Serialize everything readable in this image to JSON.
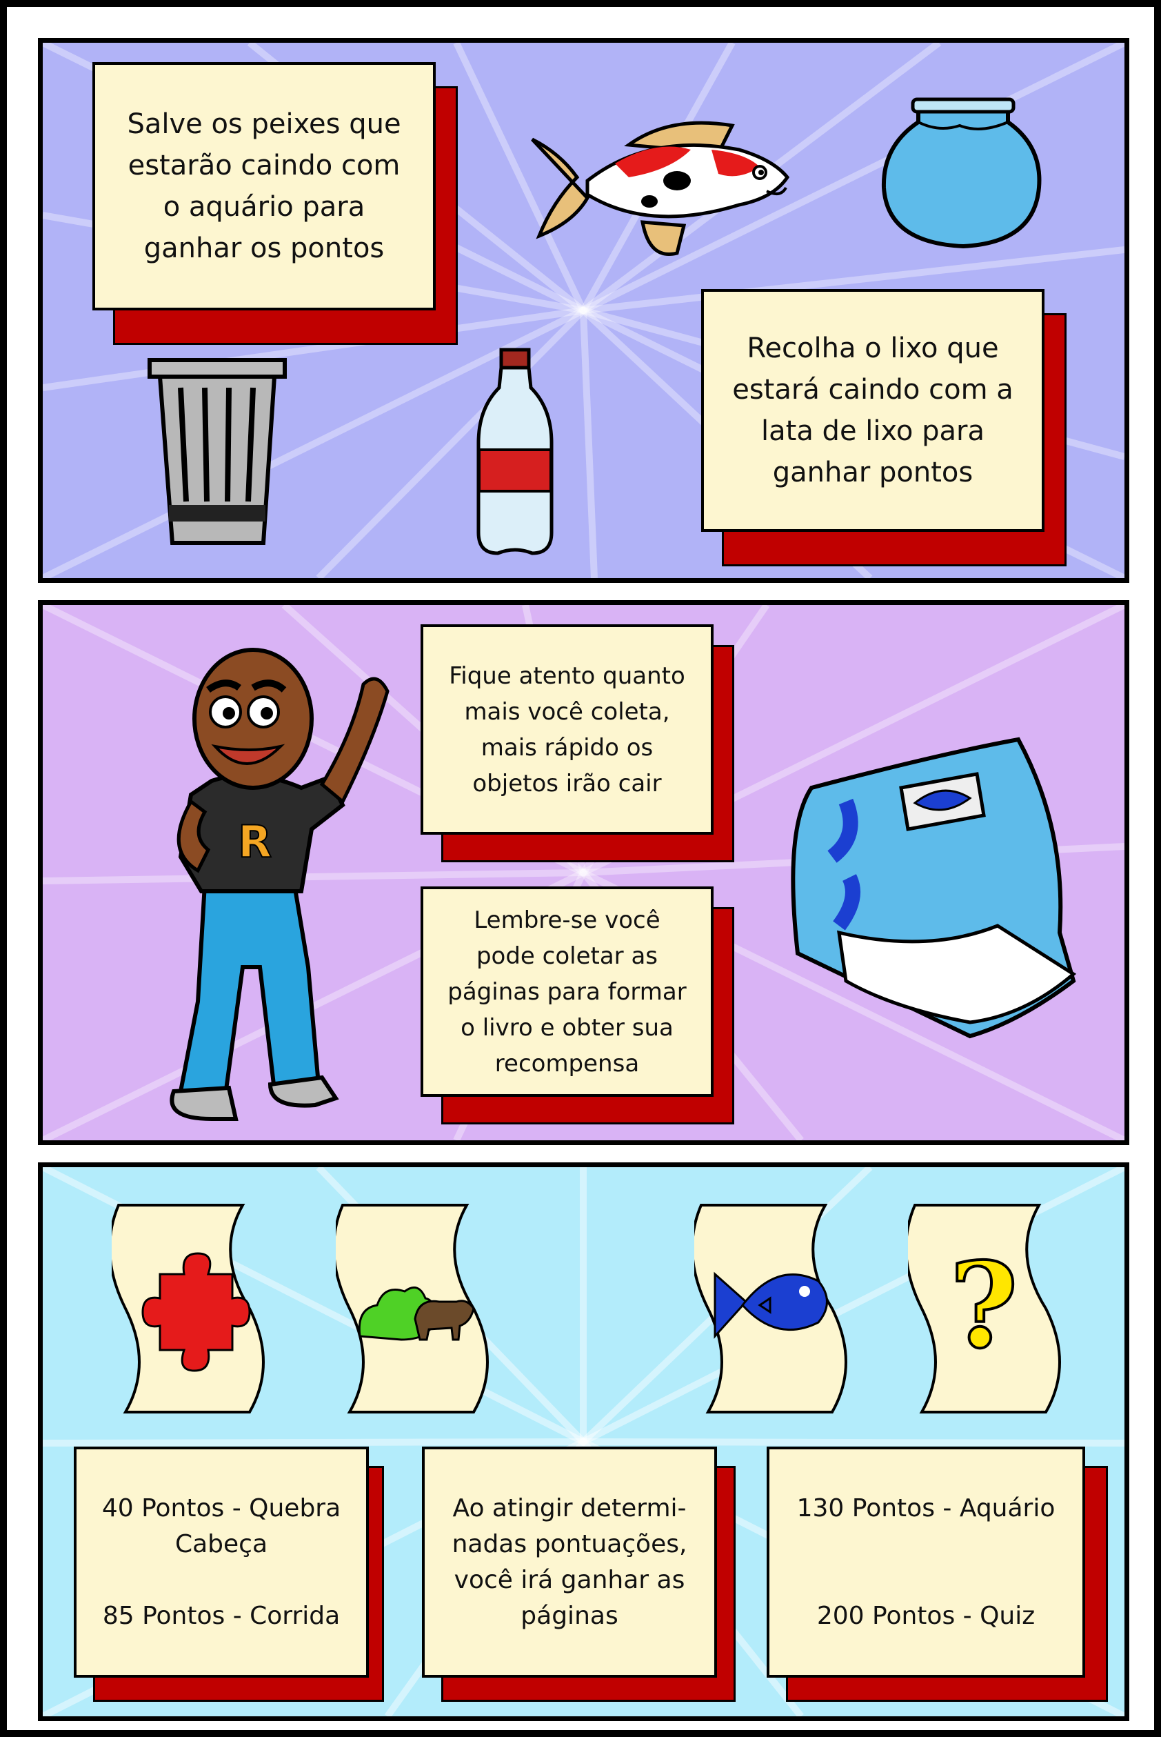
{
  "panel1": {
    "fish_text": "Salve os peixes que\nestarão caindo com\no aquário para\nganhar os pontos",
    "trash_text": "Recolha o lixo que\nestará caindo com a\nlata de lixo para\nganhar pontos"
  },
  "panel2": {
    "speed_text": "Fique atento quanto\nmais você coleta,\nmais rápido os\nobjetos irão cair",
    "pages_text": "Lembre-se você\npode coletar as\npáginas para formar\no livro e obter sua\nrecompensa",
    "shirt_letter": "R"
  },
  "panel3": {
    "rewards_left": "40 Pontos - Quebra\nCabeça\n\n85 Pontos - Corrida",
    "rewards_middle": "Ao atingir determi-\nnadas pontuações,\nvocê irá ganhar as\npáginas",
    "rewards_right": "130 Pontos - Aquário\n\n\n200 Pontos - Quiz",
    "question_mark": "?"
  },
  "colors": {
    "panel1_bg": "#b1b3f7",
    "panel2_bg": "#d9b3f5",
    "panel3_bg": "#b3ecfb",
    "card_bg": "#fdf6d0",
    "shadow": "#c00000"
  }
}
